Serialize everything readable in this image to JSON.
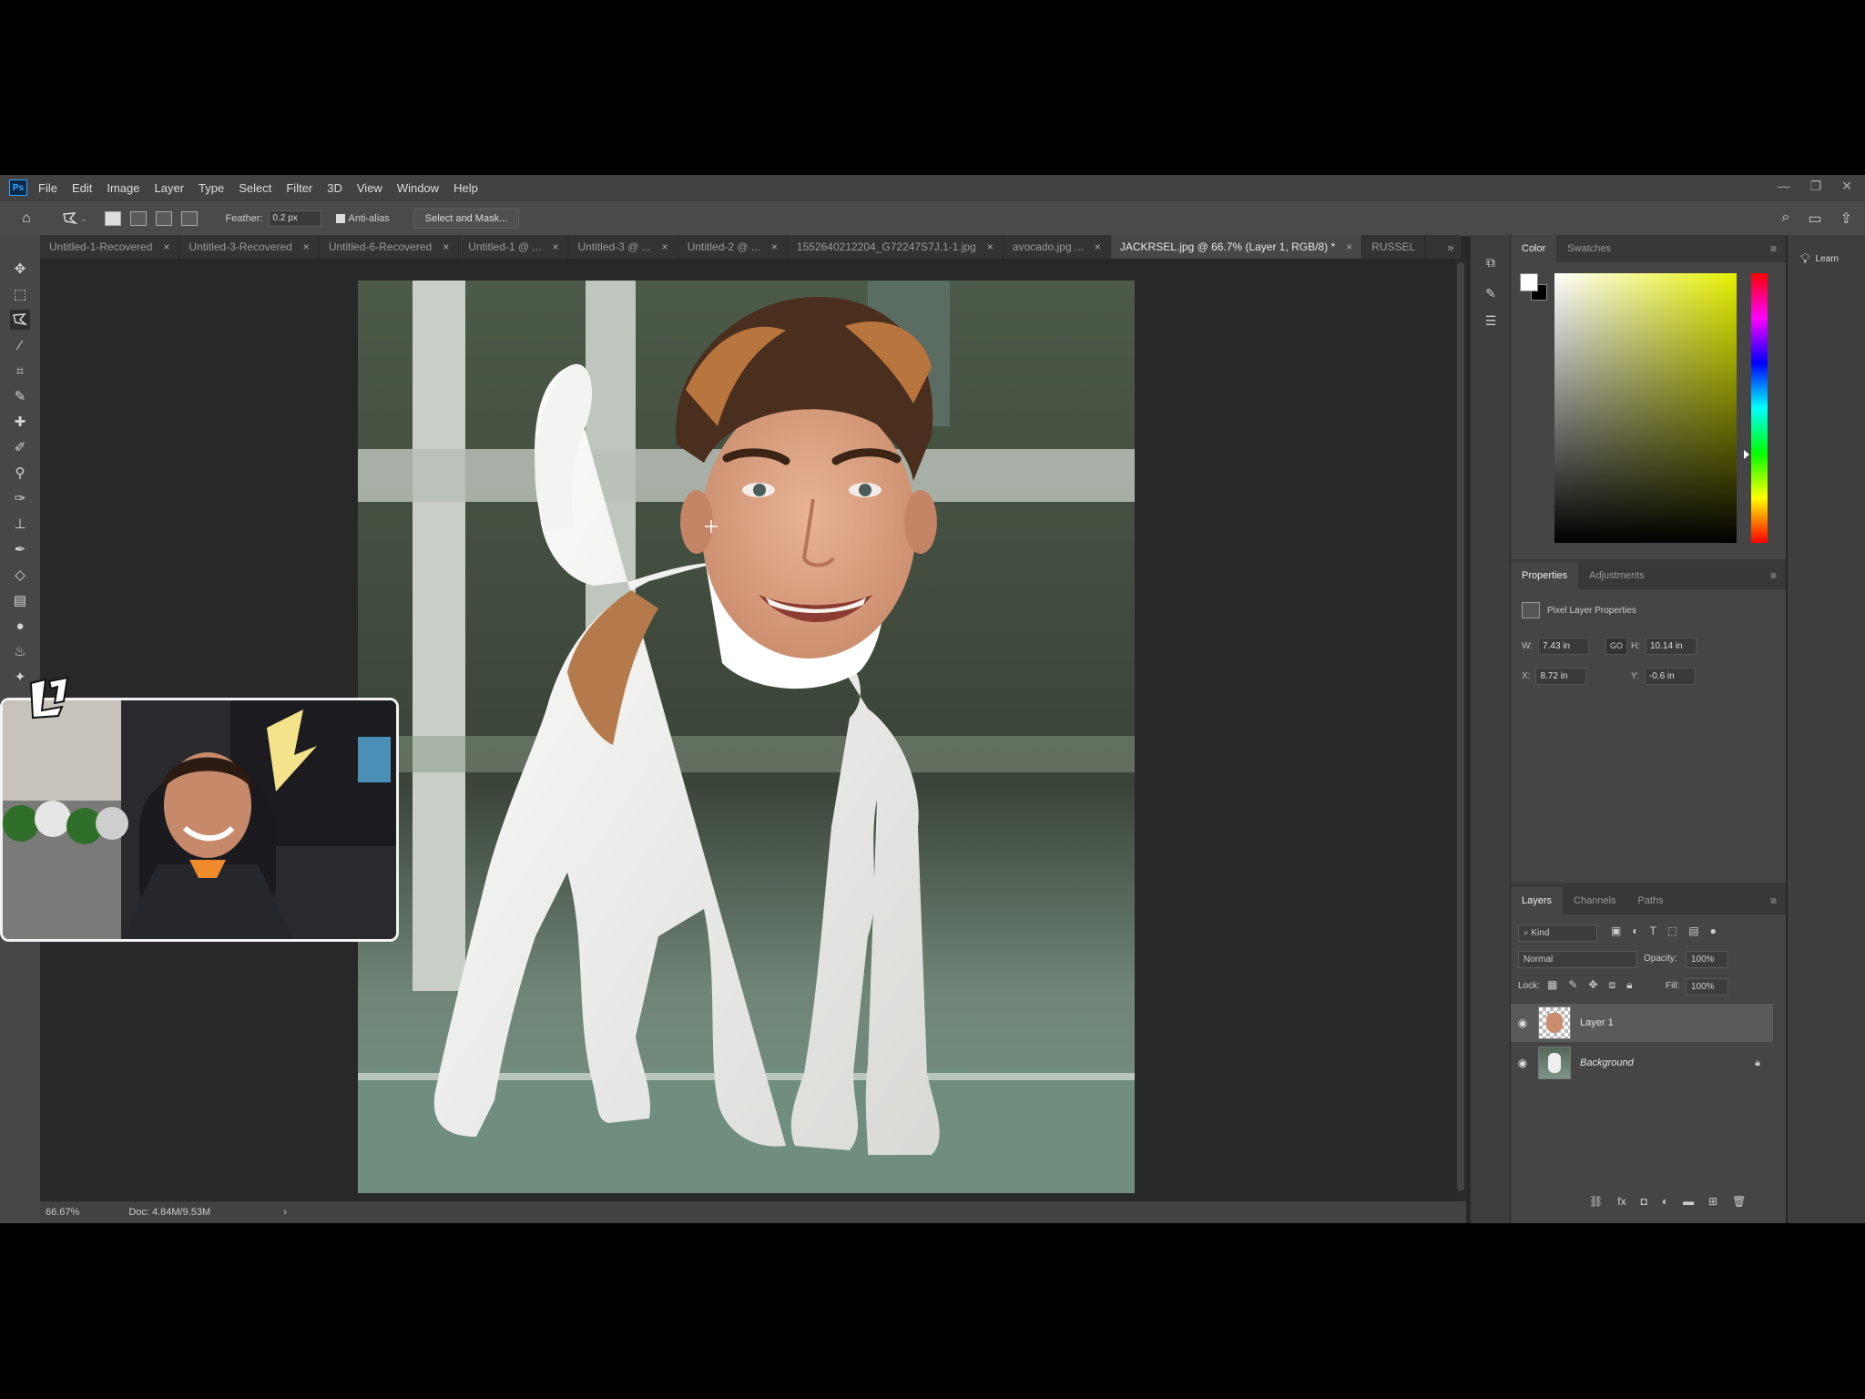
{
  "app": {
    "logo": "Ps",
    "menu": [
      "File",
      "Edit",
      "Image",
      "Layer",
      "Type",
      "Select",
      "Filter",
      "3D",
      "View",
      "Window",
      "Help"
    ],
    "window_controls": [
      "—",
      "❐",
      "✕"
    ]
  },
  "options": {
    "feather_label": "Feather:",
    "feather_value": "0.2 px",
    "antialias_label": "Anti-alias",
    "select_mask_label": "Select and Mask..."
  },
  "tabs": [
    {
      "label": "Untitled-1-Recovered",
      "active": false
    },
    {
      "label": "Untitled-3-Recovered",
      "active": false
    },
    {
      "label": "Untitled-6-Recovered",
      "active": false
    },
    {
      "label": "Untitled-1 @ ...",
      "active": false
    },
    {
      "label": "Untitled-3 @ ...",
      "active": false
    },
    {
      "label": "Untitled-2 @ ...",
      "active": false
    },
    {
      "label": "1552640212204_G72247S7J.1-1.jpg",
      "active": false
    },
    {
      "label": "avocado.jpg ...",
      "active": false
    },
    {
      "label": "JACKRSEL.jpg @ 66.7% (Layer 1, RGB/8) *",
      "active": true
    },
    {
      "label": "RUSSEL",
      "active": false
    }
  ],
  "tabs_more": "»",
  "status": {
    "zoom": "66.67%",
    "doc": "Doc: 4.84M/9.53M",
    "arrow": "›"
  },
  "color_panel": {
    "tabs": [
      "Color",
      "Swatches"
    ]
  },
  "properties_panel": {
    "tabs": [
      "Properties",
      "Adjustments"
    ],
    "title": "Pixel Layer Properties",
    "w_label": "W:",
    "w_value": "7.43 in",
    "h_label": "H:",
    "h_value": "10.14 in",
    "x_label": "X:",
    "x_value": "8.72 in",
    "y_label": "Y:",
    "y_value": "-0.6 in",
    "link_label": "GO"
  },
  "layers_panel": {
    "tabs": [
      "Layers",
      "Channels",
      "Paths"
    ],
    "kind_label": "Kind",
    "blend_mode": "Normal",
    "opacity_label": "Opacity:",
    "opacity_value": "100%",
    "lock_label": "Lock:",
    "fill_label": "Fill:",
    "fill_value": "100%",
    "layers": [
      {
        "name": "Layer 1",
        "selected": true
      },
      {
        "name": "Background",
        "selected": false,
        "locked": true
      }
    ]
  },
  "learn": {
    "label": "Learn"
  },
  "colors": {
    "accent": "#31a8ff",
    "panel": "#454545",
    "canvas": "#282828"
  }
}
